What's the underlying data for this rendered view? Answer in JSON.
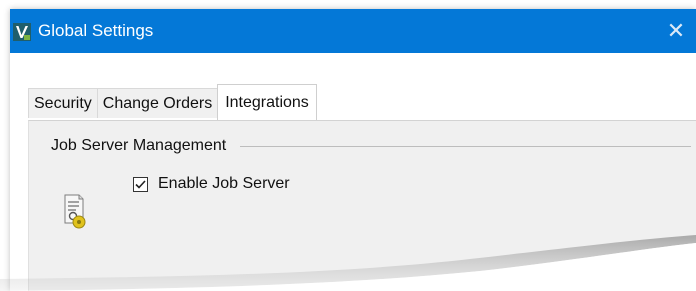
{
  "window": {
    "title": "Global Settings",
    "close_glyph": "✕",
    "app_icon": "vault-app-icon",
    "titlebar_color": "#0478d7"
  },
  "tabs": [
    {
      "label": "Security",
      "active": false
    },
    {
      "label": "Change Orders",
      "active": false
    },
    {
      "label": "Integrations",
      "active": true
    }
  ],
  "panel": {
    "group_title": "Job Server Management",
    "job_server_icon": "job-server-document-icon",
    "enable_job_server": {
      "label": "Enable Job Server",
      "checked": true
    }
  }
}
